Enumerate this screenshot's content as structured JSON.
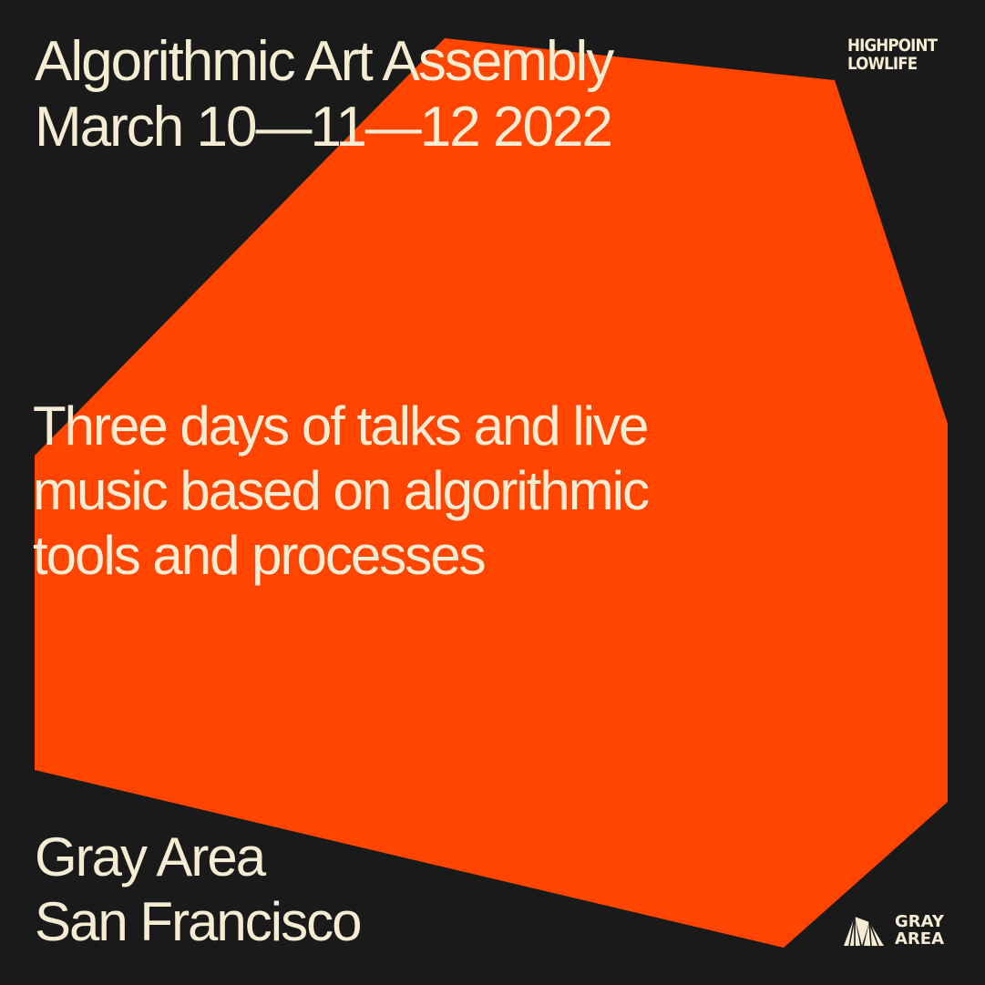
{
  "colors": {
    "background": "#1a1a1a",
    "shape": "#ff4500",
    "text": "#f5ecd4"
  },
  "event": {
    "title": "Algorithmic Art Assembly",
    "dates": "March 10—11—12 2022"
  },
  "description": {
    "line1": "Three days of talks and live",
    "line2": "music based on algorithmic",
    "line3": "tools and processes"
  },
  "venue": {
    "name": "Gray Area",
    "city": "San Francisco"
  },
  "logos": {
    "highpoint_lowlife": {
      "line1": "HIGHPOINT",
      "line2": "LOWLIFE"
    },
    "gray_area": {
      "icon": "gray-area-triangle-icon",
      "line1": "GRAY",
      "line2": "AREA"
    }
  }
}
